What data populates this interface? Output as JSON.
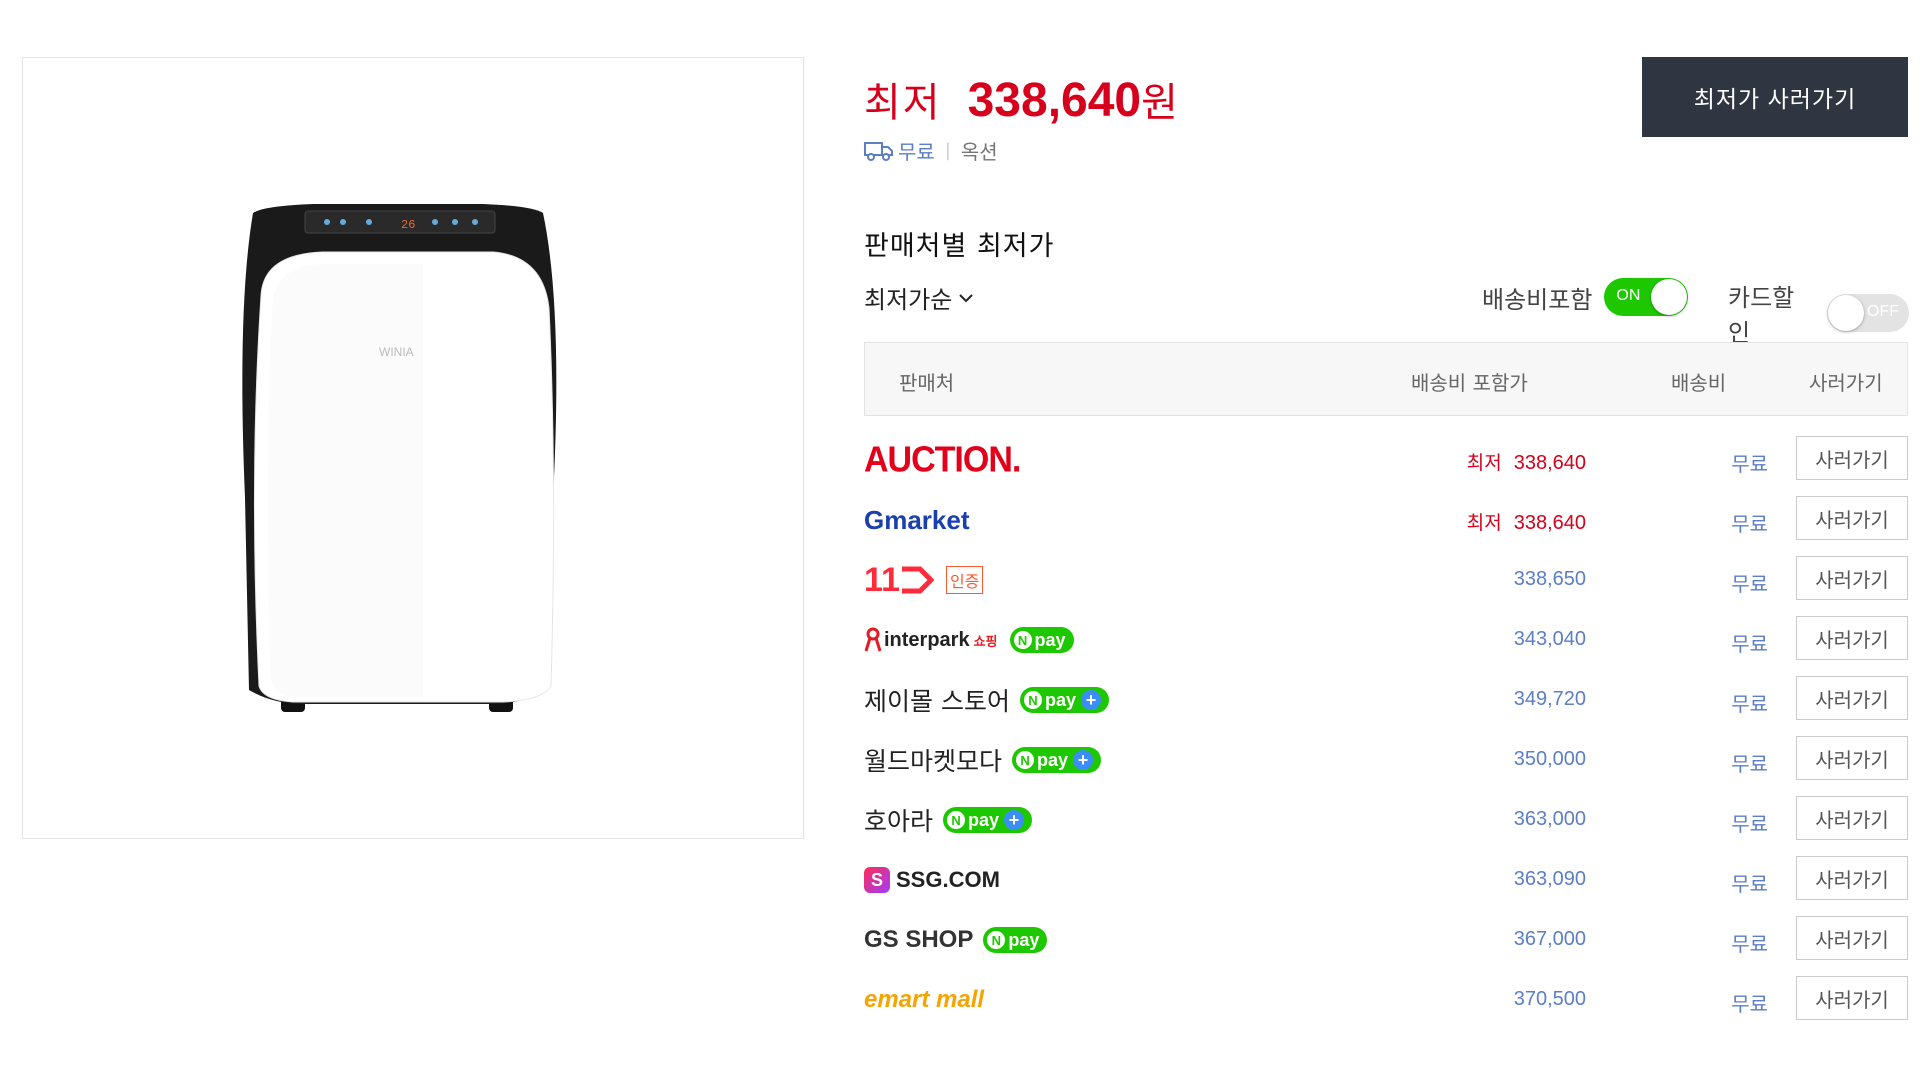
{
  "product": {
    "image_alt": "WINIA 이동식 에어컨",
    "brand_mark": "WINIA",
    "display_readout": "26"
  },
  "price": {
    "prefix": "최저",
    "value": "338,640",
    "unit": "원"
  },
  "shipping": {
    "free": "무료",
    "separator": "|",
    "seller": "옥션"
  },
  "buy_lowest_button": "최저가 사러가기",
  "section_title": "판매처별 최저가",
  "sort": {
    "label": "최저가순"
  },
  "toggles": {
    "shipping_included": {
      "label": "배송비포함",
      "state": "ON"
    },
    "card_discount": {
      "label": "카드할인",
      "state": "OFF"
    }
  },
  "table": {
    "headers": {
      "seller": "판매처",
      "price_with_shipping": "배송비 포함가",
      "shipping": "배송비",
      "buy": "사러가기"
    },
    "rows": [
      {
        "seller": "AUCTION.",
        "logo": "auction-logo",
        "lowest_tag": "최저",
        "price": "338,640",
        "shipping": "무료",
        "buy": "사러가기"
      },
      {
        "seller": "Gmarket",
        "logo": "gmarket-logo",
        "lowest_tag": "최저",
        "price": "338,640",
        "shipping": "무료",
        "buy": "사러가기"
      },
      {
        "seller": "11",
        "logo": "11st-logo",
        "badge": "인증",
        "price": "338,650",
        "shipping": "무료",
        "buy": "사러가기"
      },
      {
        "seller": "interpark",
        "seller_sub": "쇼핑",
        "logo": "interpark-logo",
        "npay": "pay",
        "price": "343,040",
        "shipping": "무료",
        "buy": "사러가기"
      },
      {
        "seller": "제이몰 스토어",
        "npay": "pay",
        "npay_plus": true,
        "price": "349,720",
        "shipping": "무료",
        "buy": "사러가기"
      },
      {
        "seller": "월드마켓모다",
        "npay": "pay",
        "npay_plus": true,
        "price": "350,000",
        "shipping": "무료",
        "buy": "사러가기"
      },
      {
        "seller": "호아라",
        "npay": "pay",
        "npay_plus": true,
        "price": "363,000",
        "shipping": "무료",
        "buy": "사러가기"
      },
      {
        "seller": "SSG.COM",
        "logo": "ssg-logo",
        "price": "363,090",
        "shipping": "무료",
        "buy": "사러가기"
      },
      {
        "seller": "GS SHOP",
        "logo": "gsshop-logo",
        "npay": "pay",
        "price": "367,000",
        "shipping": "무료",
        "buy": "사러가기"
      },
      {
        "seller": "emart mall",
        "logo": "emartmall-logo",
        "price": "370,500",
        "shipping": "무료",
        "buy": "사러가기"
      }
    ]
  },
  "colors": {
    "price_red": "#d6001c",
    "link_blue": "#5b7ec7",
    "toggle_on": "#1ec800",
    "button_dark": "#2f3641"
  }
}
